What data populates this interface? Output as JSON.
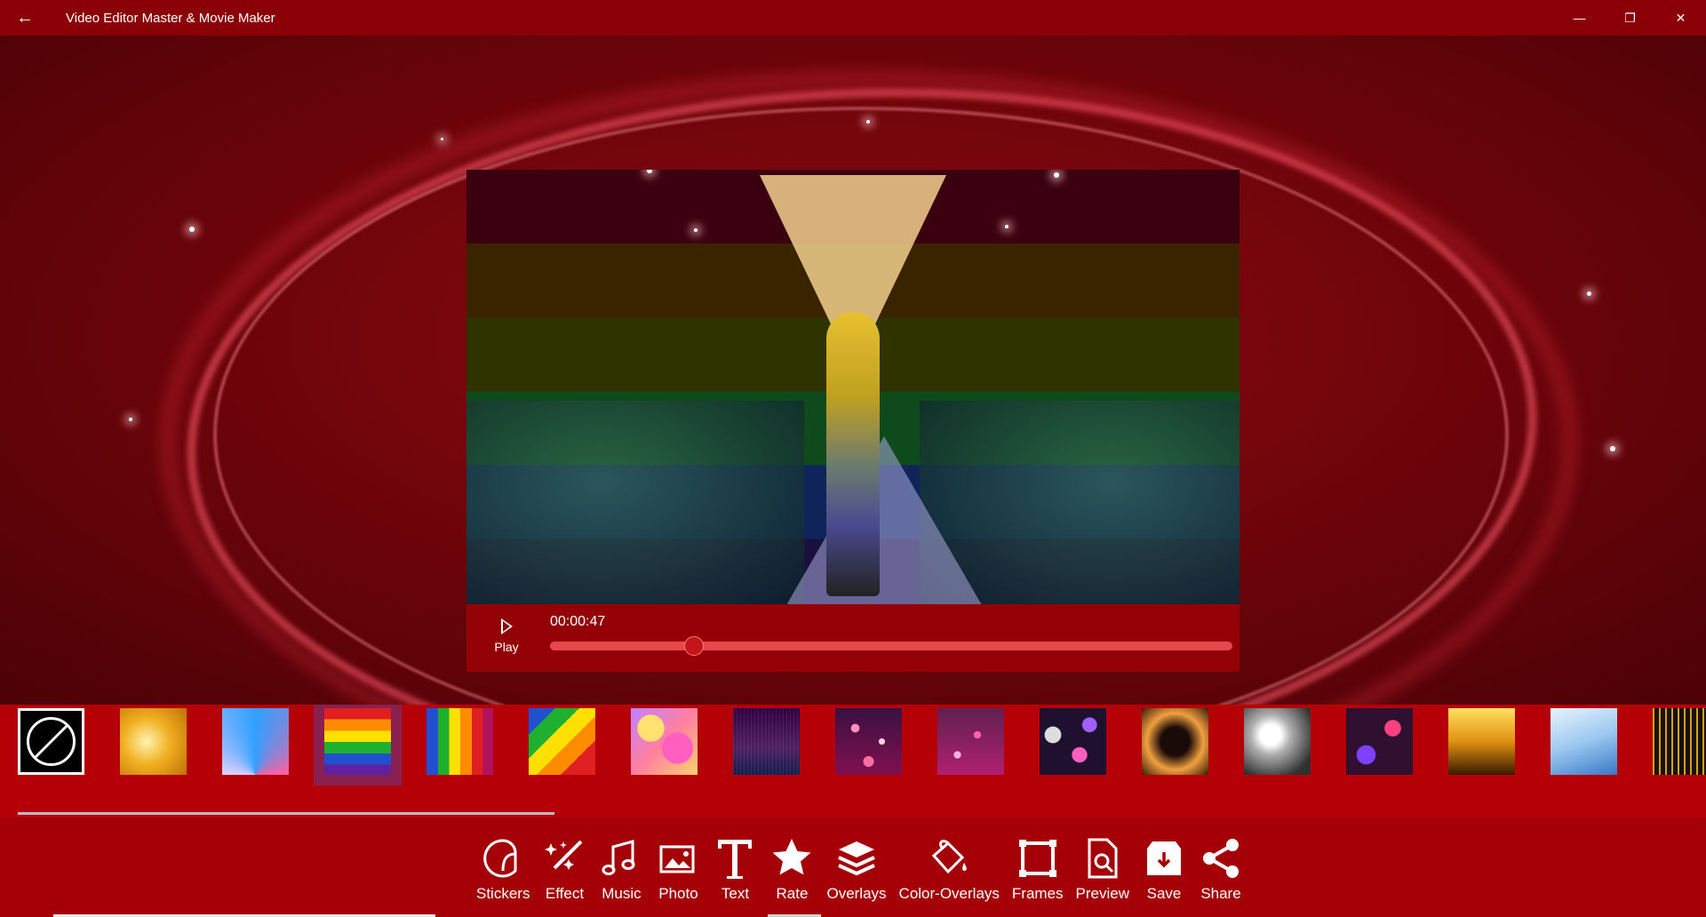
{
  "window": {
    "back_glyph": "←",
    "title": "Video Editor Master & Movie Maker",
    "minimize_glyph": "—",
    "maximize_glyph": "❐",
    "close_glyph": "✕"
  },
  "player": {
    "play_label": "Play",
    "time": "00:00:47",
    "progress": 0.21
  },
  "overlays": [
    {
      "name": "none"
    },
    {
      "name": "gold-light"
    },
    {
      "name": "stage-lights"
    },
    {
      "name": "rainbow-horizontal",
      "selected": true
    },
    {
      "name": "rainbow-vertical"
    },
    {
      "name": "rainbow-diagonal"
    },
    {
      "name": "pastel-blobs"
    },
    {
      "name": "purple-grid"
    },
    {
      "name": "pink-bokeh"
    },
    {
      "name": "magenta-bokeh"
    },
    {
      "name": "dark-bokeh"
    },
    {
      "name": "dark-sparkle"
    },
    {
      "name": "white-flare"
    },
    {
      "name": "purple-lights"
    },
    {
      "name": "golden-rays"
    },
    {
      "name": "blue-sky"
    },
    {
      "name": "gold-glitter"
    }
  ],
  "toolbar": {
    "items": [
      {
        "label": "Stickers",
        "icon": "sticker-icon"
      },
      {
        "label": "Effect",
        "icon": "magic-wand-icon"
      },
      {
        "label": "Music",
        "icon": "music-icon"
      },
      {
        "label": "Photo",
        "icon": "photo-icon"
      },
      {
        "label": "Text",
        "icon": "text-icon"
      },
      {
        "label": "Rate",
        "icon": "star-icon"
      },
      {
        "label": "Overlays",
        "icon": "layers-icon"
      },
      {
        "label": "Color-Overlays",
        "icon": "paint-bucket-icon"
      },
      {
        "label": "Frames",
        "icon": "frame-icon"
      },
      {
        "label": "Preview",
        "icon": "preview-icon"
      },
      {
        "label": "Save",
        "icon": "save-icon"
      },
      {
        "label": "Share",
        "icon": "share-icon"
      }
    ]
  },
  "colors": {
    "titlebar": "#8b0007",
    "strip": "#b50008",
    "toolbar": "#a50007",
    "progress": "#e8474d",
    "selected_overlay": "#8a2050"
  }
}
